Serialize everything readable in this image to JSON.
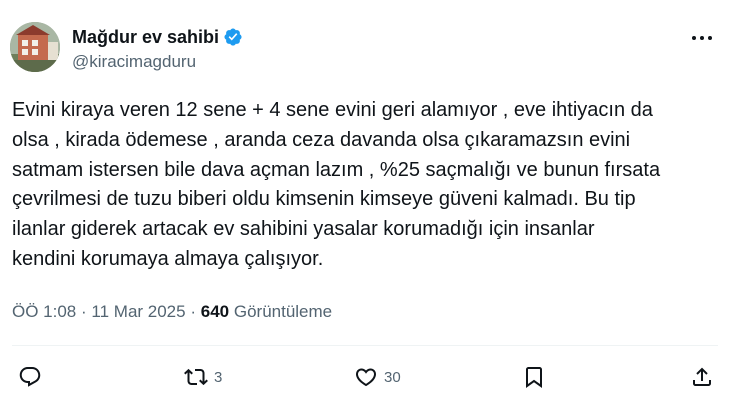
{
  "author": {
    "display_name": "Mağdur ev sahibi",
    "handle": "@kiracimagduru",
    "verified": true,
    "verified_color": "#1d9bf0"
  },
  "tweet": {
    "text_lines": [
      "Evini kiraya veren 12 sene + 4 sene evini geri alamıyor , eve ihtiyacın da",
      "olsa , kirada ödemese , aranda ceza davanda olsa çıkaramazsın evini",
      "satmam istersen bile dava açman lazım , %25 saçmalığı ve bunun fırsata",
      "çevrilmesi de tuzu biberi oldu kimsenin kimseye güveni kalmadı. Bu tip",
      "ilanlar giderek artacak ev sahibini yasalar korumadığı için insanlar",
      "kendini korumaya almaya çalışıyor."
    ],
    "time": "ÖÖ 1:08",
    "separator": "·",
    "date": "11 Mar 2025",
    "views_count": "640",
    "views_label": "Görüntüleme"
  },
  "actions": {
    "reply_icon": "reply-icon",
    "retweet_icon": "retweet-icon",
    "retweet_count": "3",
    "like_icon": "heart-icon",
    "like_count": "30",
    "bookmark_icon": "bookmark-icon",
    "share_icon": "share-icon"
  },
  "colors": {
    "text": "#0f1419",
    "secondary": "#536471",
    "divider": "#eff3f4"
  }
}
